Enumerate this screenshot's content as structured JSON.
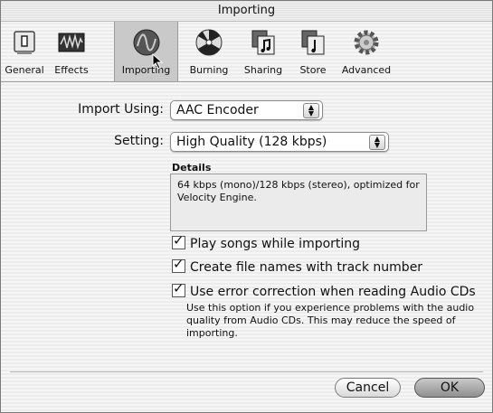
{
  "window": {
    "title": "Importing"
  },
  "toolbar": {
    "items": [
      {
        "label": "General",
        "icon": "general-icon"
      },
      {
        "label": "Effects",
        "icon": "effects-icon"
      },
      {
        "label": "Importing",
        "icon": "importing-icon",
        "selected": true
      },
      {
        "label": "Burning",
        "icon": "burning-icon"
      },
      {
        "label": "Sharing",
        "icon": "sharing-icon"
      },
      {
        "label": "Store",
        "icon": "store-icon"
      },
      {
        "label": "Advanced",
        "icon": "advanced-icon"
      }
    ]
  },
  "import_using": {
    "label": "Import Using:",
    "value": "AAC Encoder"
  },
  "setting": {
    "label": "Setting:",
    "value": "High Quality (128 kbps)"
  },
  "details": {
    "heading": "Details",
    "text": "64 kbps (mono)/128 kbps (stereo), optimized for Velocity Engine."
  },
  "options": [
    {
      "label": "Play songs while importing",
      "checked": true
    },
    {
      "label": "Create file names with track number",
      "checked": true
    },
    {
      "label": "Use error correction when reading Audio CDs",
      "checked": true
    }
  ],
  "help_text": "Use this option if you experience problems with the audio quality from Audio CDs. This may reduce the speed of importing.",
  "buttons": {
    "cancel": "Cancel",
    "ok": "OK"
  }
}
